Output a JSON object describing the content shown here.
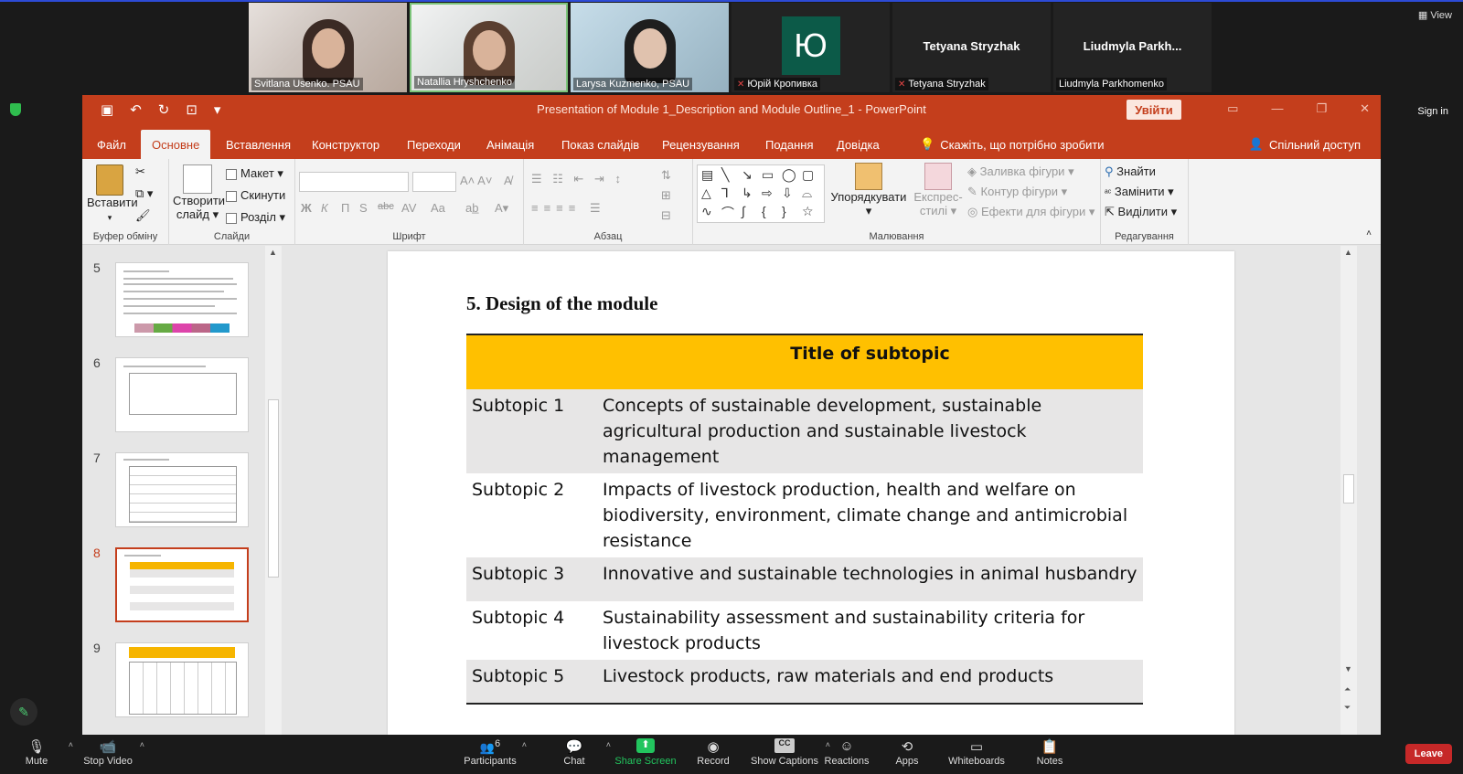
{
  "zoom": {
    "participants": [
      {
        "name": "Svitlana Usenko. PSAU",
        "type": "camera"
      },
      {
        "name": "Natallia Hryshchenko",
        "type": "camera"
      },
      {
        "name": "Larysa Kuzmenko, PSAU",
        "type": "camera"
      },
      {
        "name": "Юрій Кропивка",
        "type": "avatar",
        "initial": "Ю",
        "muted": true
      },
      {
        "name": "Tetyana Stryzhak",
        "type": "name",
        "display": "Tetyana Stryzhak",
        "muted": true
      },
      {
        "name": "Liudmyla Parkhomenko",
        "type": "name",
        "display": "Liudmyla  Parkh..."
      }
    ],
    "view_label": "View",
    "sign_in_label": "Sign in",
    "toolbar": {
      "mute": "Mute",
      "stop_video": "Stop Video",
      "participants": "Participants",
      "participants_count": "6",
      "chat": "Chat",
      "share_screen": "Share Screen",
      "record": "Record",
      "show_captions": "Show Captions",
      "reactions": "Reactions",
      "apps": "Apps",
      "whiteboards": "Whiteboards",
      "notes": "Notes",
      "leave": "Leave"
    }
  },
  "ppt": {
    "window_title": "Presentation of Module 1_Description and Module Outline_1  -  PowerPoint",
    "login_button": "Увійти",
    "tabs": [
      "Файл",
      "Основне",
      "Вставлення",
      "Конструктор",
      "Переходи",
      "Анімація",
      "Показ слайдів",
      "Рецензування",
      "Подання",
      "Довідка"
    ],
    "active_tab": "Основне",
    "tell_me": "Скажіть, що потрібно зробити",
    "share": "Спільний доступ",
    "ribbon": {
      "clipboard": {
        "label": "Буфер обміну",
        "paste": "Вставити"
      },
      "slides": {
        "label": "Слайди",
        "new_slide_1": "Створити",
        "new_slide_2": "слайд",
        "layout": "Макет",
        "reset": "Скинути",
        "section": "Розділ"
      },
      "font": {
        "label": "Шрифт",
        "bold": "Ж",
        "italic": "К",
        "underline": "П",
        "shadow": "S",
        "strike": "abc",
        "spacing": "AV",
        "case": "Aa"
      },
      "paragraph": {
        "label": "Абзац"
      },
      "drawing": {
        "label": "Малювання",
        "arrange": "Упорядкувати",
        "styles_1": "Експрес-",
        "styles_2": "стилі",
        "fill": "Заливка фігури",
        "outline": "Контур фігури",
        "effects": "Ефекти для фігури"
      },
      "editing": {
        "label": "Редагування",
        "find": "Знайти",
        "replace": "Замінити",
        "select": "Виділити"
      }
    },
    "slide_numbers": [
      "5",
      "6",
      "7",
      "8",
      "9"
    ],
    "selected_slide": "8",
    "slide": {
      "heading": "5. Design of the module",
      "table_header": "Title of subtopic",
      "rows": [
        {
          "name": "Subtopic 1",
          "text": "Concepts of sustainable development, sustainable agricultural production and sustainable livestock management"
        },
        {
          "name": "Subtopic 2",
          "text": "Impacts of livestock production, health and welfare on biodiversity, environment, climate change and antimicrobial resistance"
        },
        {
          "name": "Subtopic 3",
          "text": "Innovative and sustainable technologies in animal husbandry"
        },
        {
          "name": "Subtopic 4",
          "text": "Sustainability assessment and sustainability criteria for livestock products"
        },
        {
          "name": "Subtopic 5",
          "text": "Livestock products, raw materials and end products"
        }
      ]
    }
  },
  "colors": {
    "accent": "#c43e1c",
    "table_header": "#ffc000",
    "row_alt": "#e7e6e6",
    "zoom_green": "#22c55e",
    "leave": "#c62828"
  }
}
